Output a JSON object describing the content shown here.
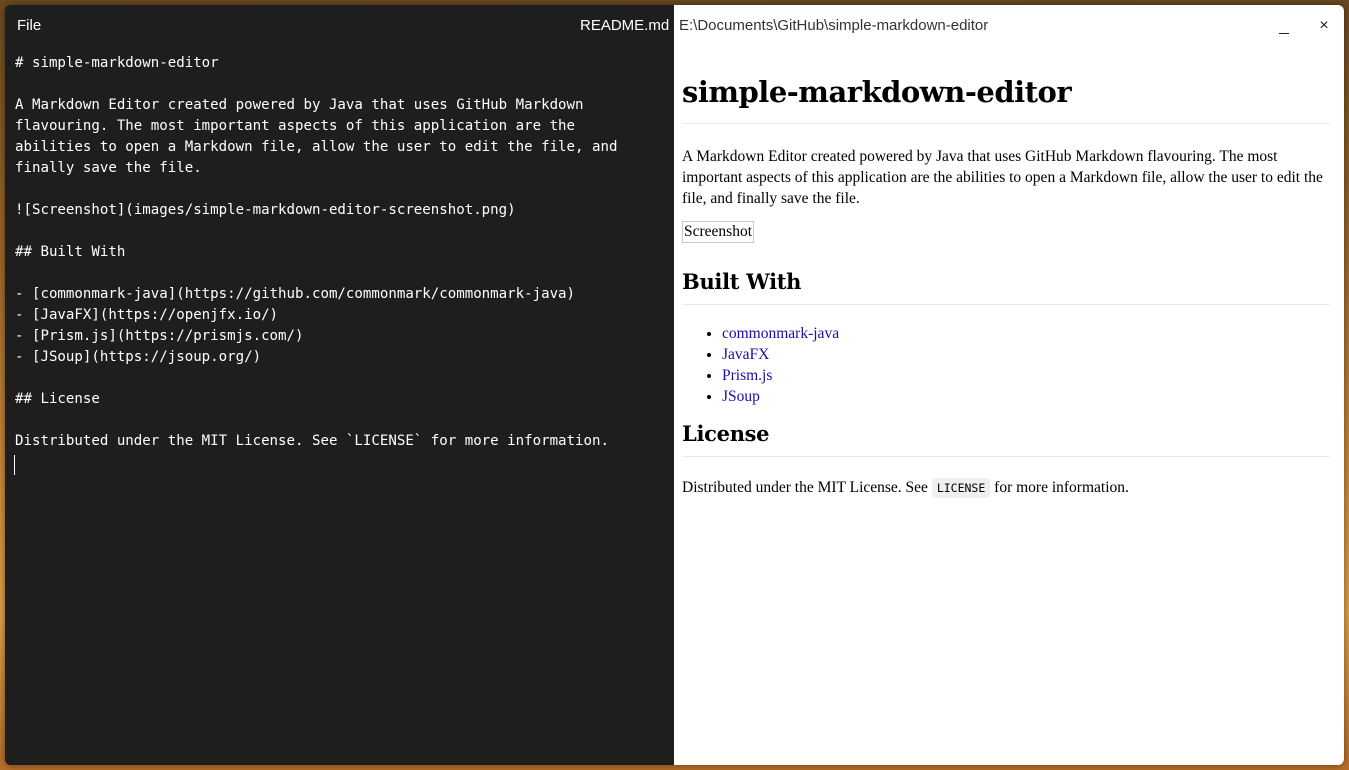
{
  "menu": {
    "file_label": "File"
  },
  "file": {
    "name": "README.md",
    "path": "E:\\Documents\\GitHub\\simple-markdown-editor"
  },
  "window_controls": {
    "minimize": "_",
    "close": "×"
  },
  "editor": {
    "text": "# simple-markdown-editor\n\nA Markdown Editor created powered by Java that uses GitHub Markdown\nflavouring. The most important aspects of this application are the\nabilities to open a Markdown file, allow the user to edit the file, and\nfinally save the file.\n\n![Screenshot](images/simple-markdown-editor-screenshot.png)\n\n## Built With\n\n- [commonmark-java](https://github.com/commonmark/commonmark-java)\n- [JavaFX](https://openjfx.io/)\n- [Prism.js](https://prismjs.com/)\n- [JSoup](https://jsoup.org/)\n\n## License\n\nDistributed under the MIT License. See `LICENSE` for more information."
  },
  "preview": {
    "title": "simple-markdown-editor",
    "intro": "A Markdown Editor created powered by Java that uses GitHub Markdown flavouring. The most important aspects of this application are the abilities to open a Markdown file, allow the user to edit the file, and finally save the file.",
    "image_alt": "Screenshot",
    "built_with_heading": "Built With",
    "links": [
      "commonmark-java",
      "JavaFX",
      "Prism.js",
      "JSoup"
    ],
    "license_heading": "License",
    "license_before": "Distributed under the MIT License. See ",
    "license_code": "LICENSE",
    "license_after": " for more information."
  },
  "colors": {
    "editor_bg": "#1e1e1e",
    "editor_text": "#ffffff",
    "preview_bg": "#ffffff",
    "link": "#1a0dab"
  }
}
